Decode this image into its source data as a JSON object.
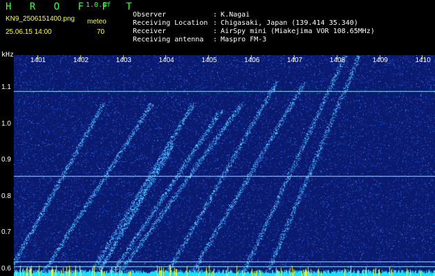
{
  "header": {
    "app_title": "H R O F F T",
    "version": "1.0.0f",
    "filename": "KN9_2506151400.png",
    "meteo_label": "meteo",
    "meteo_value": "70",
    "datetime": "25.06.15 14:00",
    "unit_label": "kHz"
  },
  "metadata": [
    {
      "label": "Observer",
      "value": "K.Nagai"
    },
    {
      "label": "Receiving Location",
      "value": "Chigasaki, Japan (139.414 35.340)"
    },
    {
      "label": "Receiver",
      "value": "AirSpy mini (Miakejima VOR 108.65MHz)"
    },
    {
      "label": "Receiving antenna",
      "value": "Maspro FM-3"
    }
  ],
  "separator": ":",
  "chart_data": {
    "type": "heatmap",
    "xlabel": "",
    "ylabel": "kHz",
    "x_ticks": [
      "1401",
      "1402",
      "1403",
      "1404",
      "1405",
      "1406",
      "1407",
      "1408",
      "1409",
      "1410"
    ],
    "y_ticks": [
      "1.1",
      "1.0",
      "0.9",
      "0.8",
      "0.7",
      "0.6"
    ],
    "ylim": [
      0.58,
      1.19
    ],
    "xlim": [
      1400.45,
      1410.3
    ],
    "horizontal_lines_khz": [
      1.09,
      0.857,
      0.62,
      0.607
    ],
    "colors": {
      "background": "#0a1a6e",
      "noise": "#2f78ff",
      "trace": "#4fc8ff",
      "line": "#8fe6ff",
      "bottom_band_cyan": "#19e2ff",
      "bottom_band_yellow": "#f4f21a",
      "tick": "#ffff33"
    }
  }
}
